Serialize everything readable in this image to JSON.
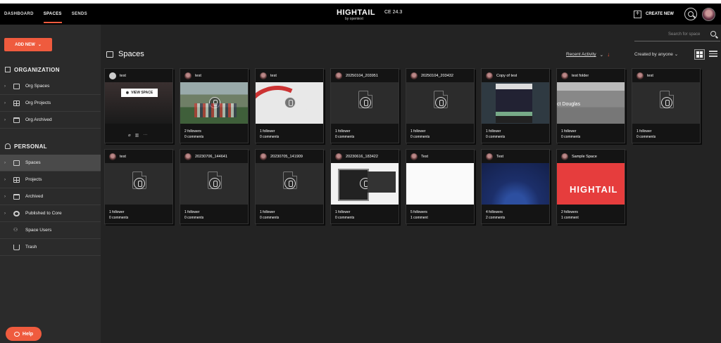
{
  "nav": {
    "dashboard": "DASHBOARD",
    "spaces": "SPACES",
    "sends": "SENDS"
  },
  "brand": {
    "logo": "HIGHTAIL",
    "version": "CE 24.3",
    "by": "by opentext"
  },
  "header": {
    "create_new": "CREATE NEW"
  },
  "sidebar": {
    "add_new": "ADD NEW",
    "organization": "ORGANIZATION",
    "org_items": [
      "Org Spaces",
      "Org Projects",
      "Org Archived"
    ],
    "personal": "PERSONAL",
    "personal_items": [
      "Spaces",
      "Projects",
      "Archived",
      "Published to Core",
      "Space Users",
      "Trash"
    ]
  },
  "help": "Help",
  "main": {
    "search_placeholder": "Search for space",
    "title": "Spaces",
    "sort_label": "Recent Activity",
    "filter_label": "Created by anyone",
    "view_space": "VIEW SPACE"
  },
  "cards": [
    {
      "name": "test",
      "followers": "",
      "comments": ""
    },
    {
      "name": "test",
      "followers": "2 followers",
      "comments": "0 comments"
    },
    {
      "name": "test",
      "followers": "1 follower",
      "comments": "0 comments"
    },
    {
      "name": "20250104_203951",
      "followers": "1 follower",
      "comments": "0 comments"
    },
    {
      "name": "20250104_203432",
      "followers": "1 follower",
      "comments": "0 comments"
    },
    {
      "name": "Copy of test",
      "followers": "1 follower",
      "comments": "0 comments"
    },
    {
      "name": "test folder",
      "followers": "1 follower",
      "comments": "0 comments"
    },
    {
      "name": "test",
      "followers": "1 follower",
      "comments": "0 comments"
    },
    {
      "name": "test",
      "followers": "1 follower",
      "comments": "0 comments"
    },
    {
      "name": "20230706_144641",
      "followers": "1 follower",
      "comments": "0 comments"
    },
    {
      "name": "20230705_141909",
      "followers": "1 follower",
      "comments": "0 comments"
    },
    {
      "name": "20230616_183422",
      "followers": "1 follower",
      "comments": "0 comments"
    },
    {
      "name": "Test",
      "followers": "5 followers",
      "comments": "1 comment"
    },
    {
      "name": "Test",
      "followers": "4 followers",
      "comments": "2 comments"
    },
    {
      "name": "Sample Space",
      "followers": "2 followers",
      "comments": "1 comment"
    }
  ],
  "sample_space_thumb": "HIGHTAIL",
  "colors": {
    "accent": "#ef5b3e",
    "topbar": "#000000",
    "sidebar": "#2b2b2b",
    "main": "#232323"
  }
}
